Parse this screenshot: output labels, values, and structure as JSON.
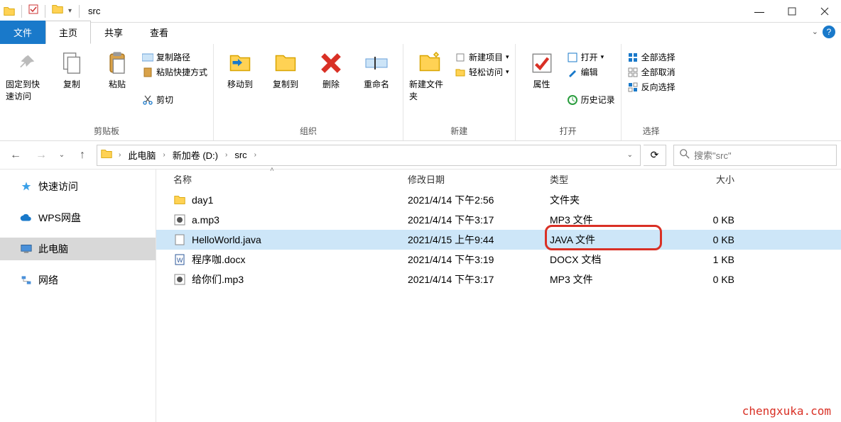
{
  "window": {
    "title": "src"
  },
  "tabs": {
    "file": "文件",
    "home": "主页",
    "share": "共享",
    "view": "查看"
  },
  "ribbon": {
    "clipboard": {
      "label": "剪贴板",
      "pin": "固定到快速访问",
      "copy": "复制",
      "paste": "粘贴",
      "copy_path": "复制路径",
      "paste_shortcut": "粘贴快捷方式",
      "cut": "剪切"
    },
    "organize": {
      "label": "组织",
      "move_to": "移动到",
      "copy_to": "复制到",
      "delete": "删除",
      "rename": "重命名"
    },
    "new": {
      "label": "新建",
      "new_folder": "新建文件夹",
      "new_item": "新建项目",
      "easy_access": "轻松访问"
    },
    "open": {
      "label": "打开",
      "properties": "属性",
      "open": "打开",
      "edit": "编辑",
      "history": "历史记录"
    },
    "select": {
      "label": "选择",
      "select_all": "全部选择",
      "select_none": "全部取消",
      "invert": "反向选择"
    }
  },
  "breadcrumbs": [
    "此电脑",
    "新加卷 (D:)",
    "src"
  ],
  "search": {
    "placeholder": "搜索\"src\""
  },
  "sidebar": {
    "items": [
      {
        "label": "快速访问"
      },
      {
        "label": "WPS网盘"
      },
      {
        "label": "此电脑"
      },
      {
        "label": "网络"
      }
    ]
  },
  "columns": {
    "name": "名称",
    "date": "修改日期",
    "type": "类型",
    "size": "大小"
  },
  "files": [
    {
      "name": "day1",
      "date": "2021/4/14 下午2:56",
      "type": "文件夹",
      "size": ""
    },
    {
      "name": "a.mp3",
      "date": "2021/4/14 下午3:17",
      "type": "MP3 文件",
      "size": "0 KB"
    },
    {
      "name": "HelloWorld.java",
      "date": "2021/4/15 上午9:44",
      "type": "JAVA 文件",
      "size": "0 KB"
    },
    {
      "name": "程序咖.docx",
      "date": "2021/4/14 下午3:19",
      "type": "DOCX 文档",
      "size": "1 KB"
    },
    {
      "name": "给你们.mp3",
      "date": "2021/4/14 下午3:17",
      "type": "MP3 文件",
      "size": "0 KB"
    }
  ],
  "watermark": "chengxuka.com"
}
